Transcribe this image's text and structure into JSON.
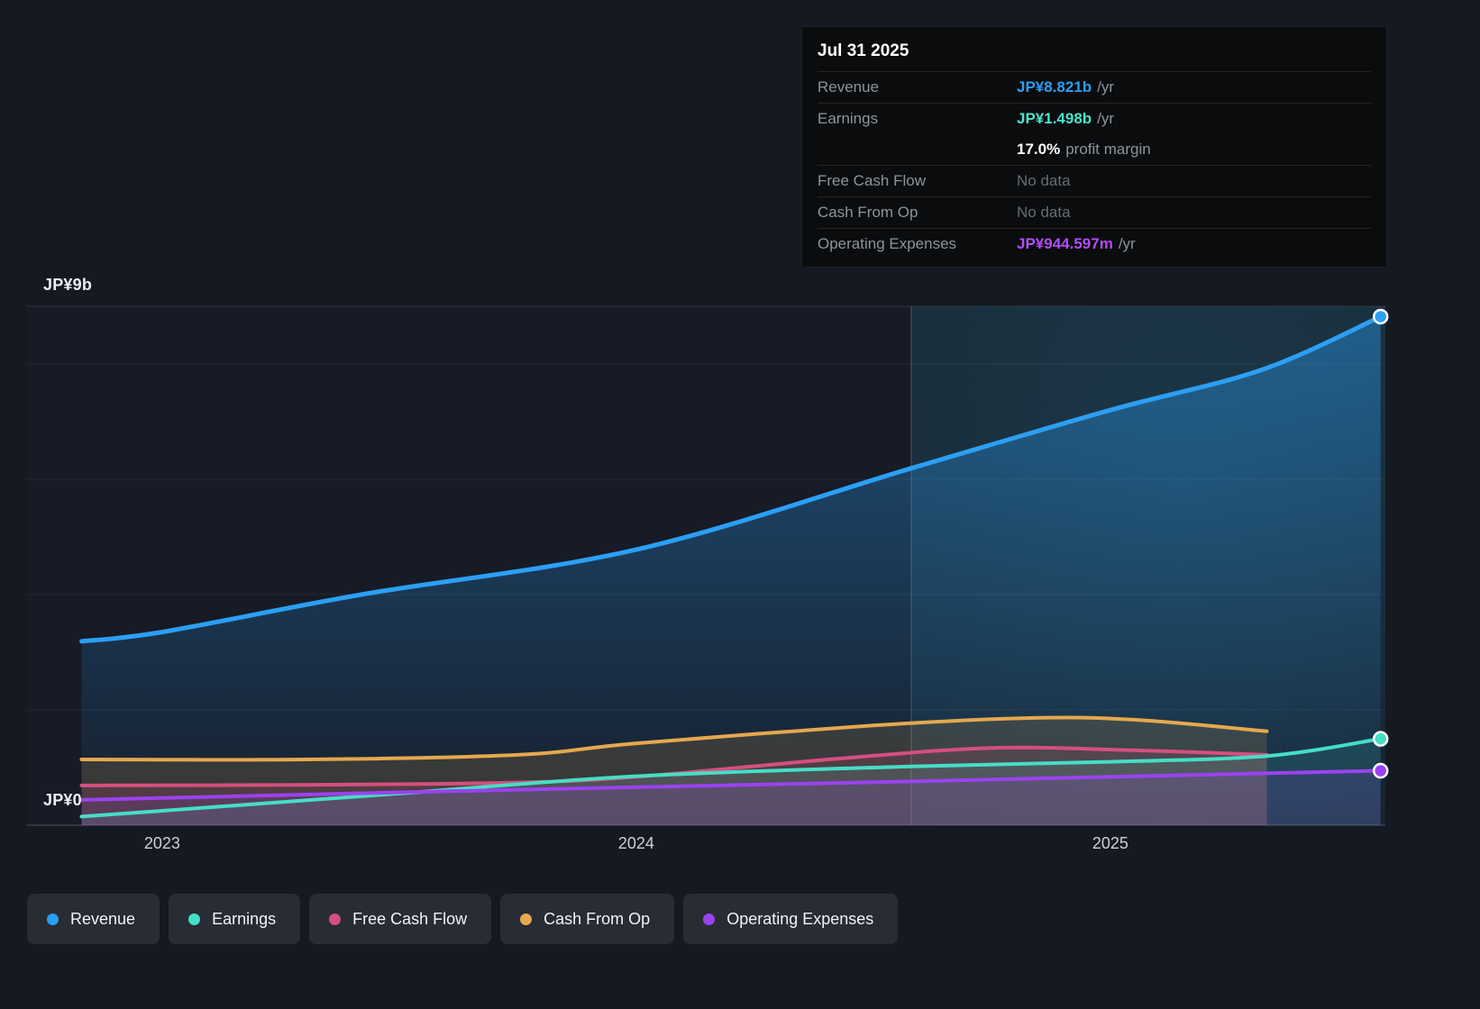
{
  "tooltip": {
    "date": "Jul 31 2025",
    "rows": [
      {
        "label": "Revenue",
        "value": "JP¥8.821b",
        "suffix": "/yr",
        "value_color": "#2b9ff5",
        "bold": true,
        "sep": true
      },
      {
        "label": "Earnings",
        "value": "JP¥1.498b",
        "suffix": "/yr",
        "value_color": "#4ee3cb",
        "bold": true,
        "sep": true
      },
      {
        "label": "",
        "value": "17.0%",
        "suffix": "profit margin",
        "value_color": "#ffffff",
        "bold": true,
        "sep": false
      },
      {
        "label": "Free Cash Flow",
        "value": "No data",
        "suffix": "",
        "value_color": "#666d76",
        "bold": false,
        "sep": true
      },
      {
        "label": "Cash From Op",
        "value": "No data",
        "suffix": "",
        "value_color": "#666d76",
        "bold": false,
        "sep": true
      },
      {
        "label": "Operating Expenses",
        "value": "JP¥944.597m",
        "suffix": "/yr",
        "value_color": "#b44df5",
        "bold": true,
        "sep": true
      }
    ]
  },
  "axis": {
    "y_top_label": "JP¥9b",
    "y_zero_label": "JP¥0",
    "x_ticks": [
      {
        "label": "2023",
        "year": 2023
      },
      {
        "label": "2024",
        "year": 2024
      },
      {
        "label": "2025",
        "year": 2025
      }
    ]
  },
  "legend": [
    {
      "label": "Revenue",
      "color": "#2b9ff5"
    },
    {
      "label": "Earnings",
      "color": "#45dec6"
    },
    {
      "label": "Free Cash Flow",
      "color": "#d44f80"
    },
    {
      "label": "Cash From Op",
      "color": "#e6a84e"
    },
    {
      "label": "Operating Expenses",
      "color": "#9b42f0"
    }
  ],
  "chart_data": {
    "type": "line",
    "title": "Earnings and revenue history",
    "unit": "JP¥ billions per year",
    "xlim": [
      2022.715,
      2025.58
    ],
    "ylim": [
      0,
      9
    ],
    "divider_x": 2024.58,
    "gridline_values": [
      0,
      2,
      4,
      6,
      8,
      9
    ],
    "colors": {
      "background": "#141922",
      "future_glow": "#2f96b8"
    },
    "series": [
      {
        "name": "Revenue",
        "color": "#2b9ff5",
        "width": 5,
        "fill": "gradient",
        "end_marker": true,
        "points": [
          [
            2022.83,
            3.19
          ],
          [
            2023.0,
            3.35
          ],
          [
            2023.42,
            4.0
          ],
          [
            2024.0,
            4.78
          ],
          [
            2024.58,
            6.19
          ],
          [
            2025.0,
            7.2
          ],
          [
            2025.32,
            7.9
          ],
          [
            2025.57,
            8.821
          ]
        ]
      },
      {
        "name": "Cash From Op",
        "color": "#e6a84e",
        "width": 4,
        "fill": "rgba(230,168,78,0.16)",
        "end_marker": false,
        "points": [
          [
            2022.83,
            1.14
          ],
          [
            2023.3,
            1.14
          ],
          [
            2023.75,
            1.22
          ],
          [
            2024.0,
            1.42
          ],
          [
            2024.5,
            1.73
          ],
          [
            2024.83,
            1.86
          ],
          [
            2025.05,
            1.83
          ],
          [
            2025.33,
            1.63
          ]
        ]
      },
      {
        "name": "Free Cash Flow",
        "color": "#d44f80",
        "width": 4,
        "fill": "rgba(212,79,128,0.16)",
        "end_marker": false,
        "points": [
          [
            2022.83,
            0.69
          ],
          [
            2023.3,
            0.7
          ],
          [
            2023.75,
            0.74
          ],
          [
            2024.0,
            0.84
          ],
          [
            2024.42,
            1.15
          ],
          [
            2024.75,
            1.34
          ],
          [
            2025.05,
            1.3
          ],
          [
            2025.33,
            1.22
          ]
        ]
      },
      {
        "name": "Earnings",
        "color": "#45dec6",
        "width": 4,
        "fill": "rgba(69,222,198,0.13)",
        "end_marker": true,
        "points": [
          [
            2022.83,
            0.15
          ],
          [
            2023.0,
            0.25
          ],
          [
            2023.5,
            0.55
          ],
          [
            2024.0,
            0.85
          ],
          [
            2024.58,
            1.02
          ],
          [
            2025.0,
            1.1
          ],
          [
            2025.33,
            1.2
          ],
          [
            2025.57,
            1.498
          ]
        ]
      },
      {
        "name": "Operating Expenses",
        "color": "#9b42f0",
        "width": 4,
        "fill": "rgba(155,66,240,0.15)",
        "end_marker": true,
        "points": [
          [
            2022.83,
            0.44
          ],
          [
            2023.5,
            0.57
          ],
          [
            2024.0,
            0.66
          ],
          [
            2024.58,
            0.76
          ],
          [
            2025.0,
            0.84
          ],
          [
            2025.57,
            0.945
          ]
        ]
      }
    ]
  }
}
